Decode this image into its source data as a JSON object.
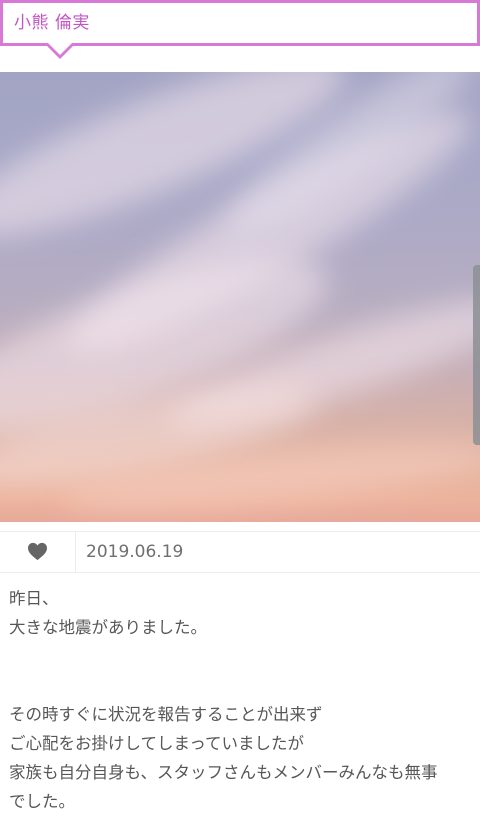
{
  "header": {
    "member_name": "小熊 倫実"
  },
  "post": {
    "date": "2019.06.19",
    "like_icon": "heart-icon",
    "body": {
      "line1": "昨日、",
      "line2": "大きな地震がありました。",
      "line3": "その時すぐに状況を報告することが出来ず",
      "line4": "ご心配をお掛けしてしまっていましたが",
      "line5": "家族も自分自身も、スタッフさんもメンバーみんなも無事",
      "line6": "でした。"
    }
  },
  "colors": {
    "accent": "#d77ad7",
    "name_text": "#c257c2",
    "body_text": "#575757"
  }
}
